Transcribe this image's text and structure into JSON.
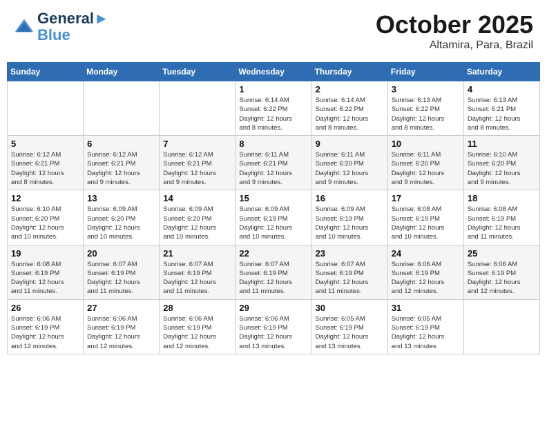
{
  "header": {
    "logo_line1": "General",
    "logo_line2": "Blue",
    "month": "October 2025",
    "location": "Altamira, Para, Brazil"
  },
  "weekdays": [
    "Sunday",
    "Monday",
    "Tuesday",
    "Wednesday",
    "Thursday",
    "Friday",
    "Saturday"
  ],
  "weeks": [
    [
      {
        "day": "",
        "info": ""
      },
      {
        "day": "",
        "info": ""
      },
      {
        "day": "",
        "info": ""
      },
      {
        "day": "1",
        "info": "Sunrise: 6:14 AM\nSunset: 6:22 PM\nDaylight: 12 hours\nand 8 minutes."
      },
      {
        "day": "2",
        "info": "Sunrise: 6:14 AM\nSunset: 6:22 PM\nDaylight: 12 hours\nand 8 minutes."
      },
      {
        "day": "3",
        "info": "Sunrise: 6:13 AM\nSunset: 6:22 PM\nDaylight: 12 hours\nand 8 minutes."
      },
      {
        "day": "4",
        "info": "Sunrise: 6:13 AM\nSunset: 6:21 PM\nDaylight: 12 hours\nand 8 minutes."
      }
    ],
    [
      {
        "day": "5",
        "info": "Sunrise: 6:12 AM\nSunset: 6:21 PM\nDaylight: 12 hours\nand 8 minutes."
      },
      {
        "day": "6",
        "info": "Sunrise: 6:12 AM\nSunset: 6:21 PM\nDaylight: 12 hours\nand 9 minutes."
      },
      {
        "day": "7",
        "info": "Sunrise: 6:12 AM\nSunset: 6:21 PM\nDaylight: 12 hours\nand 9 minutes."
      },
      {
        "day": "8",
        "info": "Sunrise: 6:11 AM\nSunset: 6:21 PM\nDaylight: 12 hours\nand 9 minutes."
      },
      {
        "day": "9",
        "info": "Sunrise: 6:11 AM\nSunset: 6:20 PM\nDaylight: 12 hours\nand 9 minutes."
      },
      {
        "day": "10",
        "info": "Sunrise: 6:11 AM\nSunset: 6:20 PM\nDaylight: 12 hours\nand 9 minutes."
      },
      {
        "day": "11",
        "info": "Sunrise: 6:10 AM\nSunset: 6:20 PM\nDaylight: 12 hours\nand 9 minutes."
      }
    ],
    [
      {
        "day": "12",
        "info": "Sunrise: 6:10 AM\nSunset: 6:20 PM\nDaylight: 12 hours\nand 10 minutes."
      },
      {
        "day": "13",
        "info": "Sunrise: 6:09 AM\nSunset: 6:20 PM\nDaylight: 12 hours\nand 10 minutes."
      },
      {
        "day": "14",
        "info": "Sunrise: 6:09 AM\nSunset: 6:20 PM\nDaylight: 12 hours\nand 10 minutes."
      },
      {
        "day": "15",
        "info": "Sunrise: 6:09 AM\nSunset: 6:19 PM\nDaylight: 12 hours\nand 10 minutes."
      },
      {
        "day": "16",
        "info": "Sunrise: 6:09 AM\nSunset: 6:19 PM\nDaylight: 12 hours\nand 10 minutes."
      },
      {
        "day": "17",
        "info": "Sunrise: 6:08 AM\nSunset: 6:19 PM\nDaylight: 12 hours\nand 10 minutes."
      },
      {
        "day": "18",
        "info": "Sunrise: 6:08 AM\nSunset: 6:19 PM\nDaylight: 12 hours\nand 11 minutes."
      }
    ],
    [
      {
        "day": "19",
        "info": "Sunrise: 6:08 AM\nSunset: 6:19 PM\nDaylight: 12 hours\nand 11 minutes."
      },
      {
        "day": "20",
        "info": "Sunrise: 6:07 AM\nSunset: 6:19 PM\nDaylight: 12 hours\nand 11 minutes."
      },
      {
        "day": "21",
        "info": "Sunrise: 6:07 AM\nSunset: 6:19 PM\nDaylight: 12 hours\nand 11 minutes."
      },
      {
        "day": "22",
        "info": "Sunrise: 6:07 AM\nSunset: 6:19 PM\nDaylight: 12 hours\nand 11 minutes."
      },
      {
        "day": "23",
        "info": "Sunrise: 6:07 AM\nSunset: 6:19 PM\nDaylight: 12 hours\nand 11 minutes."
      },
      {
        "day": "24",
        "info": "Sunrise: 6:06 AM\nSunset: 6:19 PM\nDaylight: 12 hours\nand 12 minutes."
      },
      {
        "day": "25",
        "info": "Sunrise: 6:06 AM\nSunset: 6:19 PM\nDaylight: 12 hours\nand 12 minutes."
      }
    ],
    [
      {
        "day": "26",
        "info": "Sunrise: 6:06 AM\nSunset: 6:19 PM\nDaylight: 12 hours\nand 12 minutes."
      },
      {
        "day": "27",
        "info": "Sunrise: 6:06 AM\nSunset: 6:19 PM\nDaylight: 12 hours\nand 12 minutes."
      },
      {
        "day": "28",
        "info": "Sunrise: 6:06 AM\nSunset: 6:19 PM\nDaylight: 12 hours\nand 12 minutes."
      },
      {
        "day": "29",
        "info": "Sunrise: 6:06 AM\nSunset: 6:19 PM\nDaylight: 12 hours\nand 13 minutes."
      },
      {
        "day": "30",
        "info": "Sunrise: 6:05 AM\nSunset: 6:19 PM\nDaylight: 12 hours\nand 13 minutes."
      },
      {
        "day": "31",
        "info": "Sunrise: 6:05 AM\nSunset: 6:19 PM\nDaylight: 12 hours\nand 13 minutes."
      },
      {
        "day": "",
        "info": ""
      }
    ]
  ]
}
